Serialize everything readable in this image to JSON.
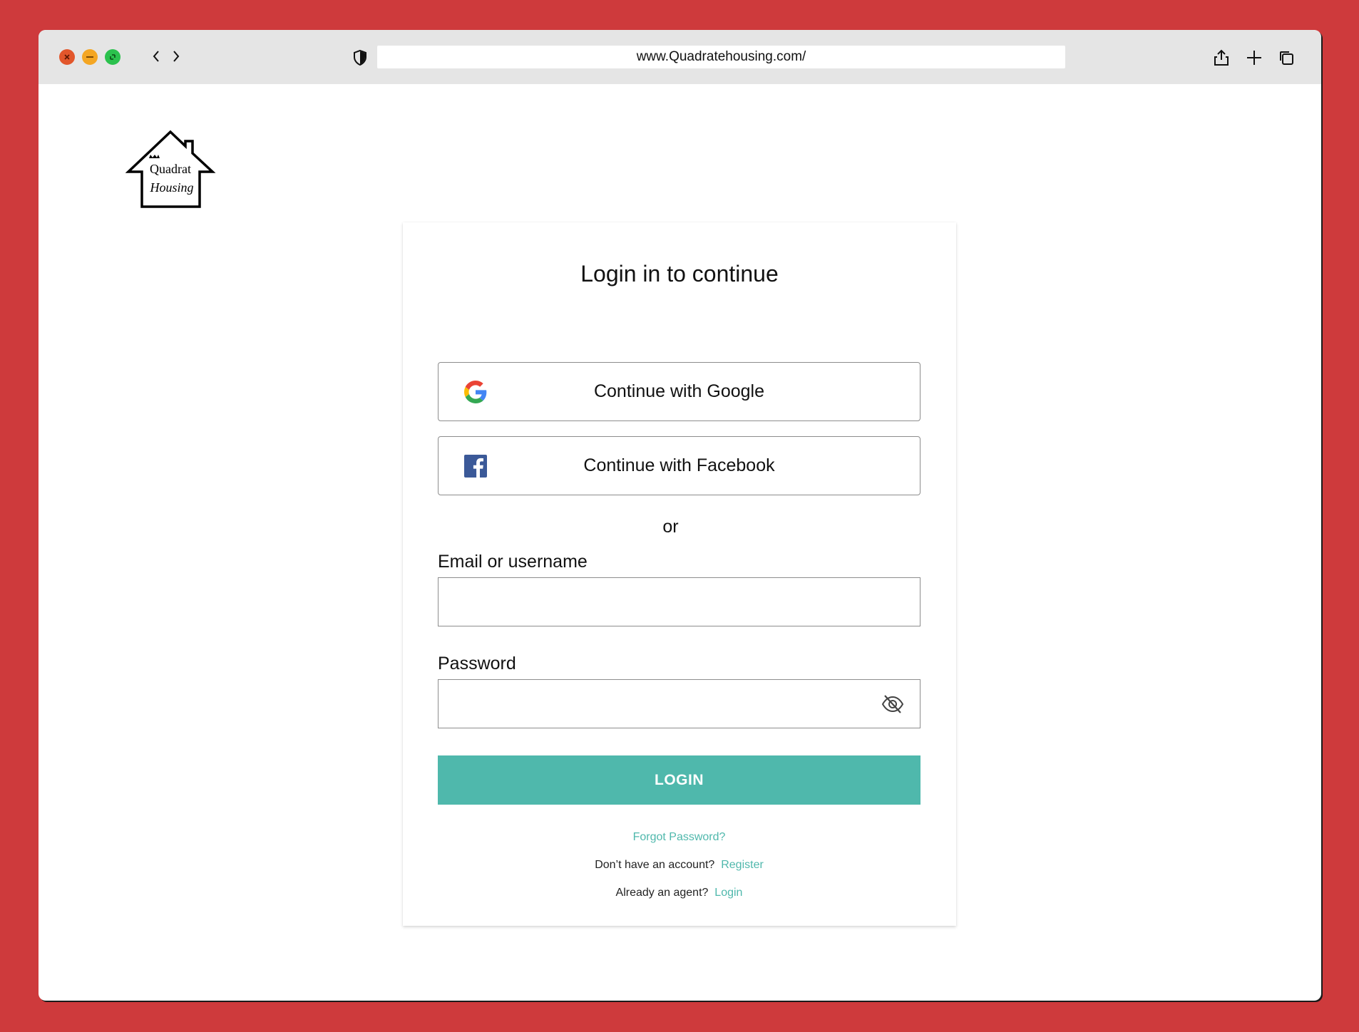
{
  "browser": {
    "url": "www.Quadratehousing.com/",
    "controls": {
      "close": "×",
      "minimize": "–",
      "maximize": "⤢"
    }
  },
  "logo": {
    "line1": "Quadrat",
    "line2": "Housing"
  },
  "login": {
    "title": "Login in to continue",
    "google_label": "Continue with Google",
    "facebook_label": "Continue with Facebook",
    "or_label": "or",
    "email_label": "Email or username",
    "email_value": "",
    "password_label": "Password",
    "password_value": "",
    "submit_label": "LOGIN",
    "forgot_label": "Forgot Password?",
    "no_account_text": "Don’t have an account?",
    "register_label": "Register",
    "agent_text": "Already an agent?",
    "agent_login_label": "Login"
  },
  "colors": {
    "accent": "#4fb8ac",
    "background": "#ce3a3c",
    "titlebar": "#e5e5e5",
    "facebook": "#3b5998"
  }
}
